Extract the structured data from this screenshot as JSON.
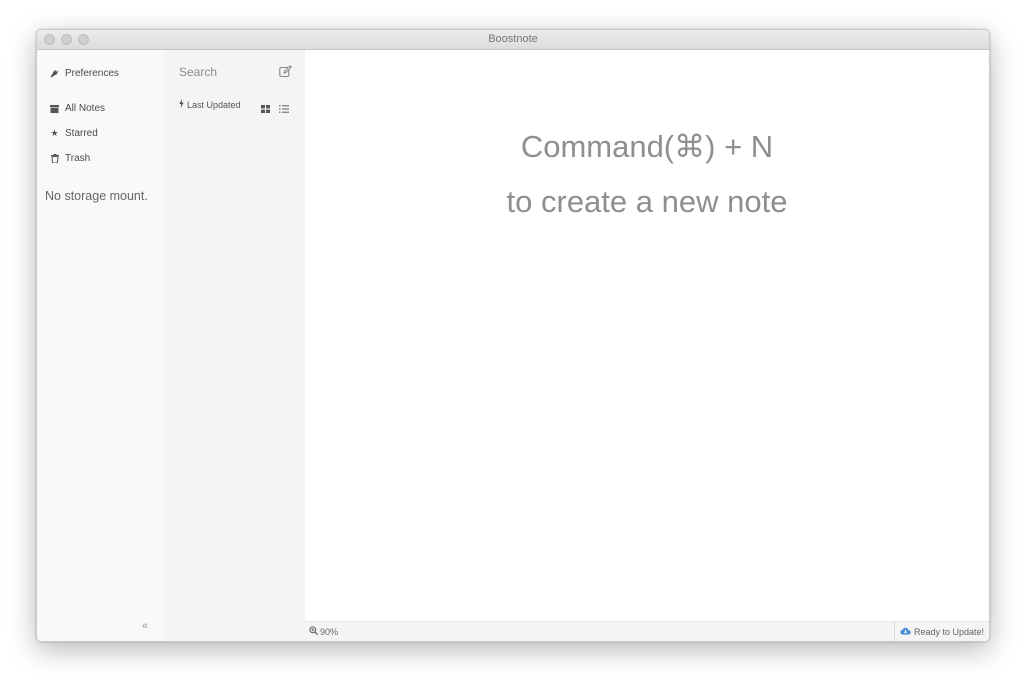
{
  "window": {
    "title": "Boostnote"
  },
  "sidebar": {
    "preferences": "Preferences",
    "items": [
      {
        "label": "All Notes",
        "icon": "archive-icon"
      },
      {
        "label": "Starred",
        "icon": "star-icon"
      },
      {
        "label": "Trash",
        "icon": "trash-icon"
      }
    ],
    "empty_storage": "No storage mount.",
    "collapse": "«"
  },
  "note_list": {
    "search_placeholder": "Search",
    "sort_label": "Last Updated"
  },
  "main": {
    "hint_line1": "Command(⌘) + N",
    "hint_line2": "to create a new note"
  },
  "status_bar": {
    "zoom": "90%",
    "update": "Ready to Update!"
  },
  "colors": {
    "accent_update_icon": "#4a90d9"
  }
}
